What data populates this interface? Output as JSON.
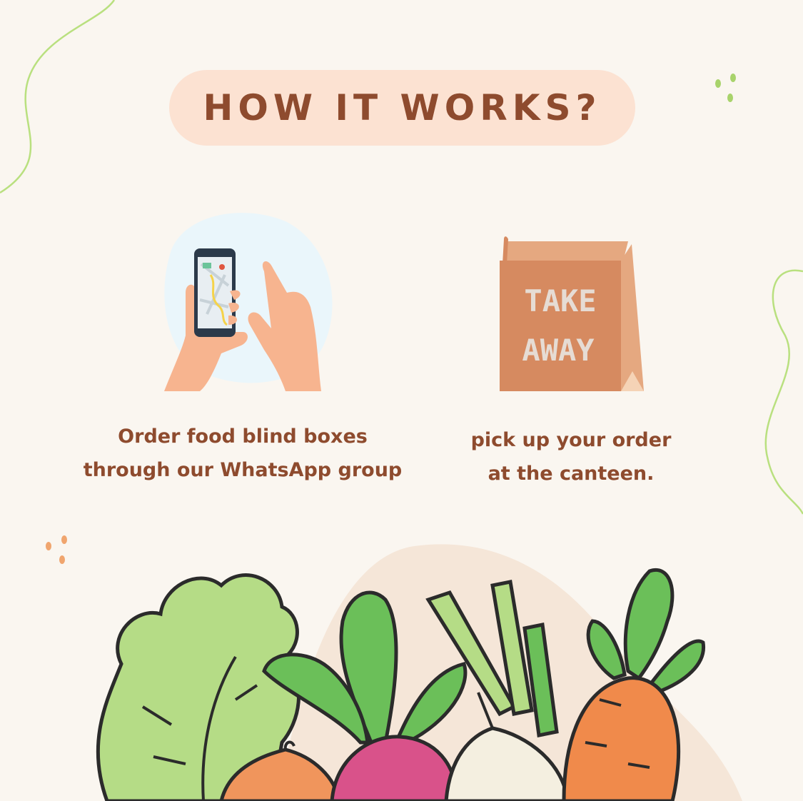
{
  "title": "HOW IT WORKS?",
  "steps": [
    {
      "icon": "smartphone-map-icon",
      "caption_lines": [
        "Order food blind boxes",
        "through our WhatsApp group"
      ]
    },
    {
      "icon": "takeaway-bag-icon",
      "bag_lines": [
        "TAKE",
        "AWAY"
      ],
      "caption_lines": [
        "pick up your order",
        "at the canteen."
      ]
    }
  ],
  "illustration": "vegetables-illustration",
  "colors": {
    "background": "#faf6f0",
    "pill": "#fce2d2",
    "text": "#8e4b2e",
    "accent_green": "#a8d36b",
    "accent_orange": "#f0a56e"
  }
}
